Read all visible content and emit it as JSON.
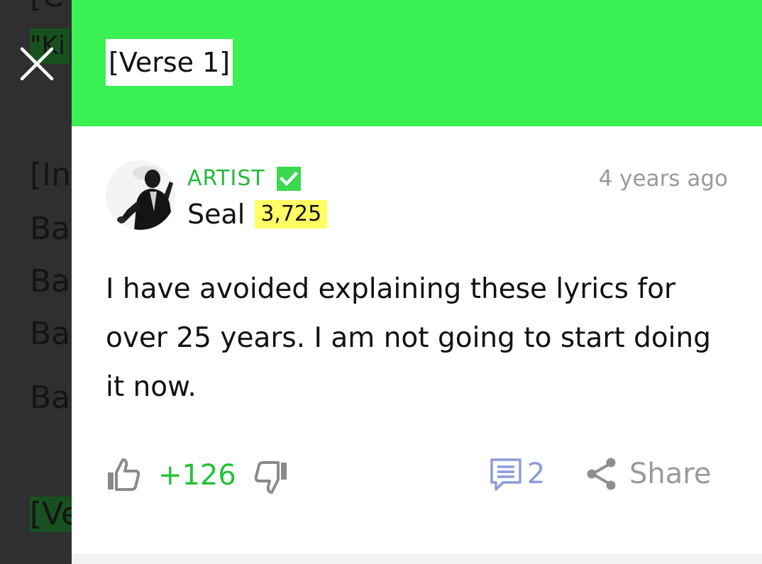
{
  "background": {
    "lines": [
      "[C",
      "\"Ki",
      "[In",
      "Ba",
      "Ba",
      "Ba",
      "Ba",
      "[Ve"
    ]
  },
  "panel": {
    "verse_label": "[Verse 1]",
    "header_color": "#3bf052"
  },
  "annotation": {
    "role": "ARTIST",
    "verified_icon": "verified-check-icon",
    "author": "Seal",
    "iq": "3,725",
    "timestamp": "4 years ago",
    "body": "I have avoided explaining these lyrics for over 25 years. I am not going to start doing it now.",
    "votes": "+126",
    "comments": "2",
    "share_label": "Share"
  },
  "colors": {
    "accent_green": "#25b83a",
    "iq_yellow": "#ffff64",
    "comment_blue": "#8b9bdc"
  }
}
